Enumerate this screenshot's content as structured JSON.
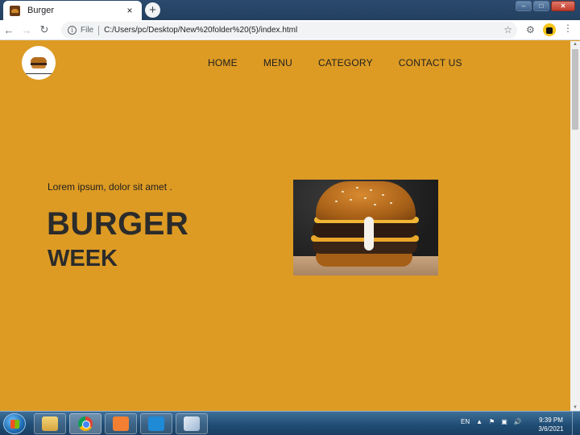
{
  "browser": {
    "tab_title": "Burger",
    "tab_close": "×",
    "new_tab": "+",
    "faded_tabs": "",
    "file_label": "File",
    "url": "C:/Users/pc/Desktop/New%20folder%20(5)/index.html",
    "window_buttons": [
      "–",
      "□",
      "✕"
    ]
  },
  "page": {
    "nav": [
      "HOME",
      "MENU",
      "CATEGORY",
      "CONTACT US"
    ],
    "hero": {
      "tagline": "Lorem ipsum, dolor sit amet .",
      "title": "BURGER",
      "subtitle": "WEEK"
    }
  },
  "taskbar": {
    "language": "EN",
    "time": "9:39 PM",
    "date": "3/6/2021"
  },
  "colors": {
    "page_background": "#dd9b24",
    "heading": "#2b2b2b"
  }
}
